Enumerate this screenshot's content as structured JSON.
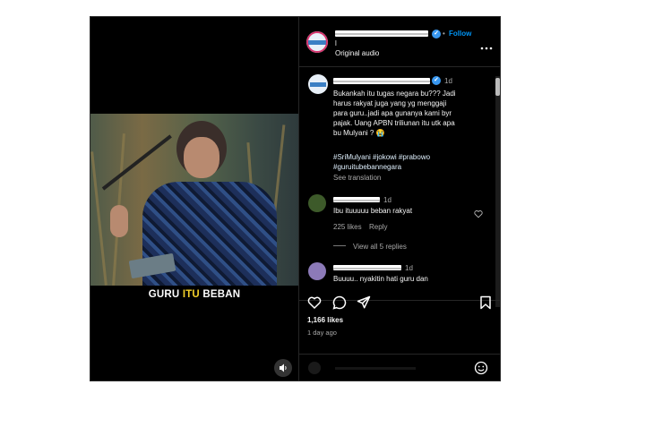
{
  "video": {
    "caption_part1": "GURU ",
    "caption_highlight": "ITU",
    "caption_part2": " BEBAN",
    "mute_icon": "speaker-icon"
  },
  "header": {
    "dot": "•",
    "follow_label": "Follow",
    "username_suffix": "l",
    "audio_label": "Original audio",
    "more_icon": "more-icon"
  },
  "caption_comment": {
    "time": "1d",
    "text_lines": [
      "Bukankah itu tugas negara bu??? Jadi",
      "harus rakyat juga yang yg menggaji",
      "para guru..jadi apa gunanya kami byr",
      "pajak. Uang APBN triliunan itu utk apa",
      "bu Mulyani ? 😭"
    ],
    "hashtag_lines": [
      "#SriMulyani #jokowi #prabowo",
      "#guruitubebannegara"
    ],
    "see_translation": "See translation"
  },
  "comments": [
    {
      "time": "1d",
      "text": "Ibu ituuuuu beban rakyat",
      "likes": "225 likes",
      "reply": "Reply",
      "view_replies": "View all 5 replies"
    },
    {
      "time": "1d",
      "text": "Buuuu.. nyakitin hati guru dan"
    }
  ],
  "actions": {
    "likes": "1,166 likes",
    "time_ago": "1 day ago"
  },
  "colors": {
    "background": "#000000",
    "accent": "#0095f6",
    "caption_highlight": "#f3d02a"
  }
}
